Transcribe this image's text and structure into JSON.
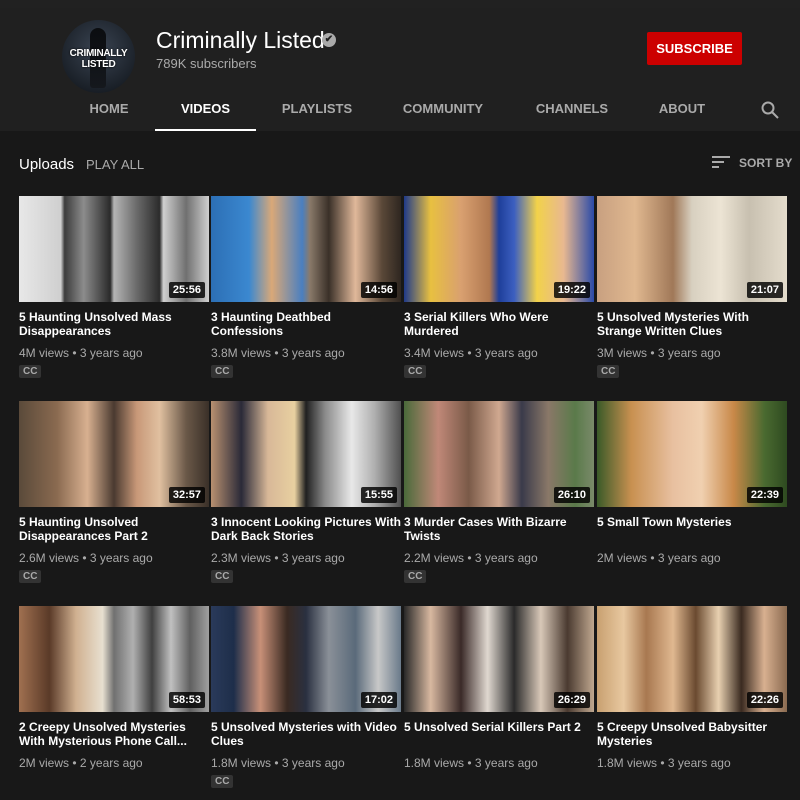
{
  "channel": {
    "name": "Criminally Listed",
    "avatar_text": "CRIMINALLY LISTED",
    "subscribers": "789K subscribers",
    "subscribe_label": "SUBSCRIBE",
    "verified_mark": "✔"
  },
  "tabs": [
    "HOME",
    "VIDEOS",
    "PLAYLISTS",
    "COMMUNITY",
    "CHANNELS",
    "ABOUT"
  ],
  "active_tab": "VIDEOS",
  "toolbar": {
    "uploads_label": "Uploads",
    "play_all_label": "PLAY ALL",
    "sort_label": "SORT BY"
  },
  "videos": [
    {
      "title": "5 Haunting Unsolved Mass Disappearances",
      "duration": "25:56",
      "views": "4M views",
      "age": "3 years ago",
      "cc": "CC"
    },
    {
      "title": "3 Haunting Deathbed Confessions",
      "duration": "14:56",
      "views": "3.8M views",
      "age": "3 years ago",
      "cc": "CC"
    },
    {
      "title": "3 Serial Killers Who Were Murdered",
      "duration": "19:22",
      "views": "3.4M views",
      "age": "3 years ago",
      "cc": "CC"
    },
    {
      "title": "5 Unsolved Mysteries With Strange Written Clues",
      "duration": "21:07",
      "views": "3M views",
      "age": "3 years ago",
      "cc": "CC"
    },
    {
      "title": "5 Haunting Unsolved Disappearances Part 2",
      "duration": "32:57",
      "views": "2.6M views",
      "age": "3 years ago",
      "cc": "CC"
    },
    {
      "title": "3 Innocent Looking Pictures With Dark Back Stories",
      "duration": "15:55",
      "views": "2.3M views",
      "age": "3 years ago",
      "cc": "CC"
    },
    {
      "title": "3 Murder Cases With Bizarre Twists",
      "duration": "26:10",
      "views": "2.2M views",
      "age": "3 years ago",
      "cc": "CC"
    },
    {
      "title": "5 Small Town Mysteries",
      "duration": "22:39",
      "views": "2M views",
      "age": "3 years ago",
      "cc": ""
    },
    {
      "title": "2 Creepy Unsolved Mysteries With Mysterious Phone Call...",
      "duration": "58:53",
      "views": "2M views",
      "age": "2 years ago",
      "cc": ""
    },
    {
      "title": "5 Unsolved Mysteries with Video Clues",
      "duration": "17:02",
      "views": "1.8M views",
      "age": "3 years ago",
      "cc": "CC"
    },
    {
      "title": "5 Unsolved Serial Killers Part 2",
      "duration": "26:29",
      "views": "1.8M views",
      "age": "3 years ago",
      "cc": ""
    },
    {
      "title": "5 Creepy Unsolved Babysitter Mysteries",
      "duration": "22:26",
      "views": "1.8M views",
      "age": "3 years ago",
      "cc": ""
    }
  ],
  "colors": {
    "background": "#181818",
    "header": "#202020",
    "subscribe": "#cc0000",
    "secondary_text": "#aaaaaa"
  }
}
